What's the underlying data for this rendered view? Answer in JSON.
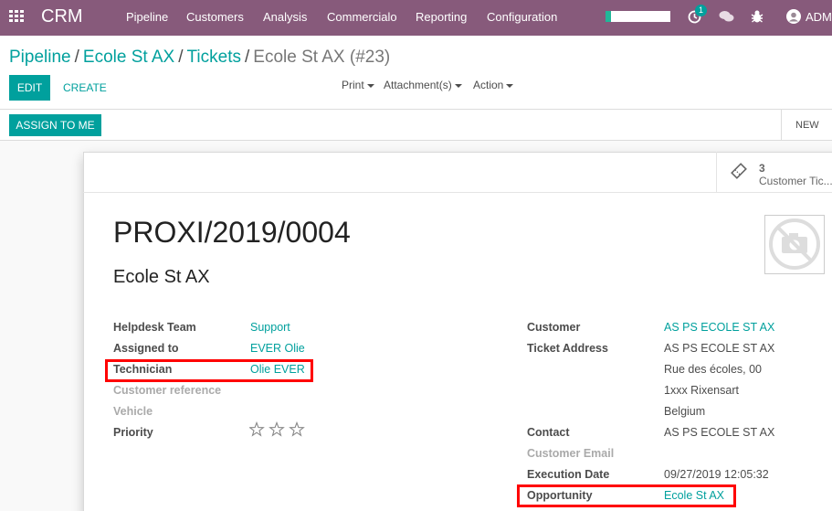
{
  "navbar": {
    "brand": "CRM",
    "menu": [
      "Pipeline",
      "Customers",
      "Analysis",
      "Commercialo",
      "Reporting",
      "Configuration"
    ],
    "activity_count": "1",
    "user": "ADM",
    "progress": 0.08,
    "accent_color": "#875a7b"
  },
  "breadcrumb": {
    "items": [
      "Pipeline",
      "Ecole St AX",
      "Tickets"
    ],
    "current": "Ecole St AX (#23)",
    "separator": "/"
  },
  "actions": {
    "edit": "EDIT",
    "create": "CREATE",
    "print": "Print",
    "attachments": "Attachment(s)",
    "action": "Action"
  },
  "statusbar": {
    "assign": "ASSIGN TO ME",
    "stage": "NEW"
  },
  "smart_button": {
    "count": "3",
    "label": "Customer Tic..."
  },
  "ticket": {
    "name": "PROXI/2019/0004",
    "partner": "Ecole St AX"
  },
  "left_fields": {
    "helpdesk_team": {
      "label": "Helpdesk Team",
      "value": "Support"
    },
    "assigned_to": {
      "label": "Assigned to",
      "value": "EVER Olie"
    },
    "technician": {
      "label": "Technician",
      "value": "Olie EVER"
    },
    "customer_reference": {
      "label": "Customer reference",
      "value": ""
    },
    "vehicle": {
      "label": "Vehicle",
      "value": ""
    },
    "priority": {
      "label": "Priority",
      "stars": 3,
      "filled": 0
    }
  },
  "right_fields": {
    "customer": {
      "label": "Customer",
      "value": "AS PS ECOLE ST AX"
    },
    "ticket_address": {
      "label": "Ticket Address",
      "lines": [
        "AS PS ECOLE ST AX",
        "Rue des écoles, 00",
        "1xxx Rixensart",
        "Belgium"
      ]
    },
    "contact": {
      "label": "Contact",
      "value": "AS PS ECOLE ST AX"
    },
    "customer_email": {
      "label": "Customer Email",
      "value": ""
    },
    "execution_date": {
      "label": "Execution Date",
      "value": "09/27/2019 12:05:32"
    },
    "opportunity": {
      "label": "Opportunity",
      "value": "Ecole St AX"
    }
  },
  "colors": {
    "primary": "#00a09d",
    "highlight": "#ff0000"
  }
}
